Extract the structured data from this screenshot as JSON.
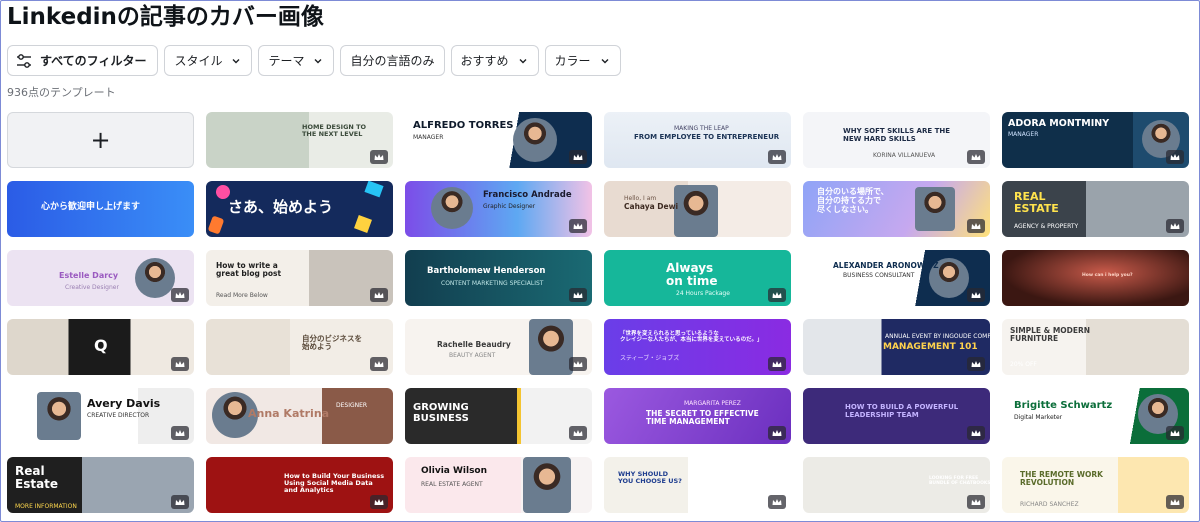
{
  "page": {
    "title": "Linkedinの記事のカバー画像"
  },
  "filters": {
    "all_label": "すべてのフィルター",
    "style_label": "スタイル",
    "theme_label": "テーマ",
    "own_language_label": "自分の言語のみ",
    "recommended_label": "おすすめ",
    "color_label": "カラー"
  },
  "results": {
    "count_text": "936点のテンプレート"
  },
  "add_card": {
    "symbol": "+"
  },
  "templates": [
    {
      "title": "HOME DESIGN TO\nTHE NEXT LEVEL"
    },
    {
      "title": "ALFREDO TORRES",
      "subtitle": "MANAGER"
    },
    {
      "title": "FROM EMPLOYEE TO ENTREPRENEUR",
      "subtitle": "MAKING THE LEAP"
    },
    {
      "title": "WHY SOFT SKILLS ARE THE\nNEW HARD SKILLS",
      "subtitle": "KORINA VILLANUEVA"
    },
    {
      "title": "ADORA MONTMINY",
      "subtitle": "MANAGER"
    },
    {
      "title": "心から歓迎申し上げます"
    },
    {
      "title": "さあ、始めよう"
    },
    {
      "title": "Francisco Andrade",
      "subtitle": "Graphic Designer"
    },
    {
      "title": "Cahaya Dewi",
      "subtitle": "Hello, I am"
    },
    {
      "title": "自分のいる場所で、\n自分の持てる力で\n尽くしなさい。"
    },
    {
      "title": "REAL\nESTATE",
      "subtitle": "AGENCY & PROPERTY"
    },
    {
      "title": "Estelle Darcy",
      "subtitle": "Creative Designer"
    },
    {
      "title": "How to write a\ngreat blog post",
      "subtitle": "Read More Below"
    },
    {
      "title": "Bartholomew Henderson",
      "subtitle": "CONTENT MARKETING SPECIALIST"
    },
    {
      "title": "Always\non time",
      "subtitle": "24 Hours Package"
    },
    {
      "title": "ALEXANDER ARONOWITZ",
      "subtitle": "BUSINESS CONSULTANT"
    },
    {
      "title": "How can i help you?"
    },
    {
      "title": "Q"
    },
    {
      "title": "自分のビジネスを\n始めよう"
    },
    {
      "title": "Rachelle Beaudry",
      "subtitle": "BEAUTY AGENT"
    },
    {
      "title": "「世界を変えられると思っているような\nクレイジーな人たちが、本当に世界を変えているのだ。」",
      "subtitle": "スティーブ・ジョブズ"
    },
    {
      "title": "MANAGEMENT 101",
      "subtitle": "ANNUAL EVENT BY INGOUDE COMPANY"
    },
    {
      "title": "SIMPLE & MODERN\nFURNITURE",
      "subtitle": "20% OFF"
    },
    {
      "title": "Avery Davis",
      "subtitle": "CREATIVE DIRECTOR"
    },
    {
      "title": "Anna Katrina",
      "subtitle": "DESIGNER"
    },
    {
      "title": "GROWING\nBUSINESS"
    },
    {
      "title": "THE SECRET TO EFFECTIVE\nTIME MANAGEMENT",
      "subtitle": "MARGARITA PEREZ"
    },
    {
      "title": "HOW TO BUILD A POWERFUL\nLEADERSHIP TEAM"
    },
    {
      "title": "Brigitte Schwartz",
      "subtitle": "Digital Marketer"
    },
    {
      "title": "Real\nEstate",
      "subtitle": "MORE INFORMATION"
    },
    {
      "title": "How to Build Your Business\nUsing Social Media Data\nand Analytics"
    },
    {
      "title": "Olivia Wilson",
      "subtitle": "REAL ESTATE AGENT"
    },
    {
      "title": "WHY SHOULD\nYOU CHOOSE US?"
    },
    {
      "title": "LOOKING FOR FREE\nBUNDLE OF CHATBOOKS"
    },
    {
      "title": "THE REMOTE WORK\nREVOLUTION",
      "subtitle": "RICHARD SANCHEZ"
    }
  ],
  "colors": {
    "accent": "#7d2ae8",
    "chip_border": "#d0d3d8",
    "frame": "#7d8bd6"
  },
  "icons": {
    "filter": "sliders-icon",
    "chevron": "chevron-down-icon",
    "premium": "crown-icon"
  }
}
